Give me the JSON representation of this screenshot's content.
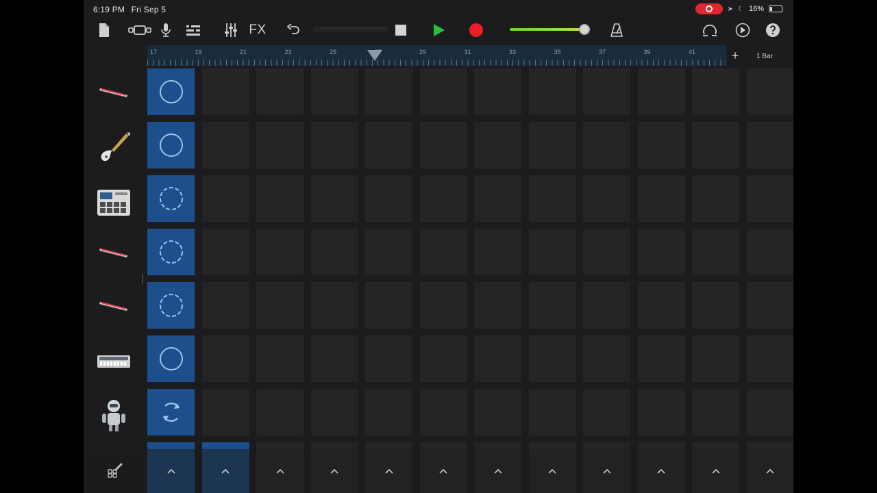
{
  "status_bar": {
    "time": "6:19 PM",
    "date": "Fri Sep 5",
    "battery": "16%",
    "recording_indicator": "screen-recording"
  },
  "toolbar": {
    "fx_label": "FX",
    "icons": [
      "document-icon",
      "tracks-view-icon",
      "microphone-icon",
      "browser-icon",
      "mixer-icon",
      "fx",
      "undo-icon",
      "stop-icon",
      "play-icon",
      "record-icon",
      "volume-slider",
      "metronome-icon",
      "loop-browser-icon",
      "settings-icon",
      "help-icon"
    ],
    "volume_level": 0.92,
    "colors": {
      "play": "#22c23a",
      "record": "#ee1c24",
      "volume": "#7cd93c"
    }
  },
  "ruler": {
    "numbers": [
      "17",
      "19",
      "21",
      "23",
      "25",
      "27",
      "29",
      "31",
      "33",
      "35",
      "37",
      "39",
      "41"
    ],
    "playhead_bar": 27,
    "bar_setting": "1 Bar"
  },
  "tracks": [
    {
      "name": "keyboard-icon",
      "type": "keyboard"
    },
    {
      "name": "bass-guitar-icon",
      "type": "bass"
    },
    {
      "name": "drum-machine-icon",
      "type": "drum machine"
    },
    {
      "name": "keyboard-icon",
      "type": "keyboard"
    },
    {
      "name": "keyboard-icon",
      "type": "keyboard"
    },
    {
      "name": "synth-keyboard-icon",
      "type": "synth"
    },
    {
      "name": "drummer-robot-icon",
      "type": "drummer"
    }
  ],
  "grid": {
    "columns": 12,
    "rows": 7,
    "filled_cells": [
      [
        0,
        0
      ],
      [
        1,
        0
      ],
      [
        2,
        0
      ],
      [
        3,
        0
      ],
      [
        4,
        0
      ],
      [
        5,
        0
      ],
      [
        6,
        0
      ]
    ],
    "partial_row_cells": [
      0,
      1
    ],
    "accent": "#1d4f8c"
  },
  "trigger_row": {
    "count": 12,
    "active": [
      0,
      1
    ]
  }
}
